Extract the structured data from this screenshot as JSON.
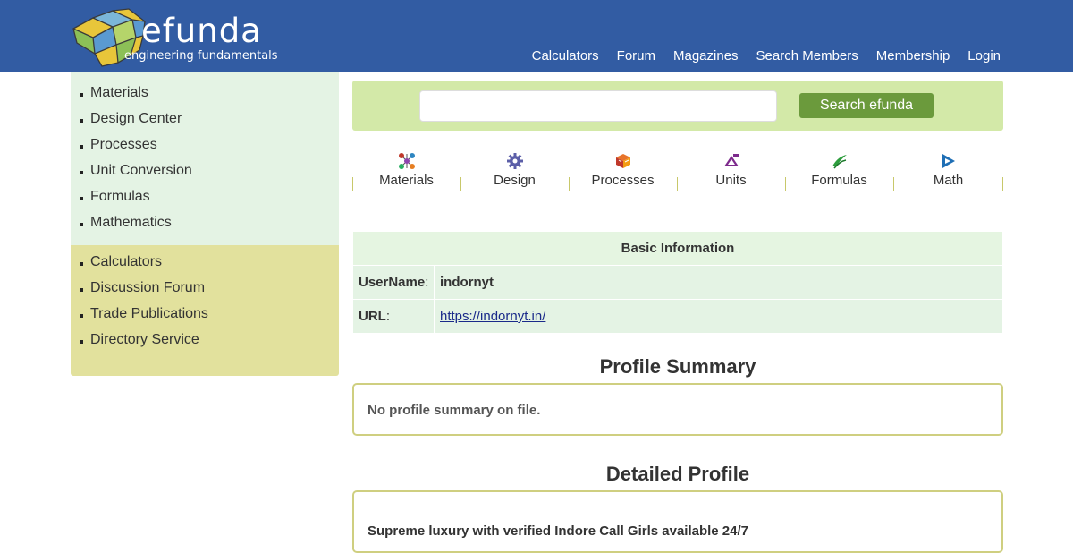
{
  "header": {
    "logo_text": "efunda",
    "logo_tagline": "engineering fundamentals",
    "nav": [
      "Calculators",
      "Forum",
      "Magazines",
      "Search Members",
      "Membership",
      "Login"
    ]
  },
  "sidebar": {
    "primary": [
      "Materials",
      "Design Center",
      "Processes",
      "Unit Conversion",
      "Formulas",
      "Mathematics"
    ],
    "secondary": [
      "Calculators",
      "Discussion Forum",
      "Trade Publications",
      "Directory Service"
    ]
  },
  "search": {
    "placeholder": "",
    "button_label": "Search efunda"
  },
  "tabs": [
    {
      "label": "Materials",
      "icon": "materials-icon"
    },
    {
      "label": "Design",
      "icon": "gear-icon"
    },
    {
      "label": "Processes",
      "icon": "processes-icon"
    },
    {
      "label": "Units",
      "icon": "units-icon"
    },
    {
      "label": "Formulas",
      "icon": "formulas-icon"
    },
    {
      "label": "Math",
      "icon": "math-icon"
    }
  ],
  "basic_info": {
    "title": "Basic Information",
    "username_label": "UserName",
    "username_value": "indornyt",
    "url_label": "URL",
    "url_value": "https://indornyt.in/",
    "colon": ":"
  },
  "profile_summary": {
    "title": "Profile Summary",
    "text": "No profile summary on file."
  },
  "detailed_profile": {
    "title": "Detailed Profile",
    "text": "Supreme luxury with verified Indore Call Girls available 24/7"
  },
  "colors": {
    "header_bg": "#325ca3",
    "sidebar_top_bg": "#e4f3e4",
    "sidebar_bottom_bg": "#e2e19d",
    "search_bg": "#d3e9a8",
    "search_button": "#6b9a3c",
    "panel_border": "#cfcf80"
  }
}
